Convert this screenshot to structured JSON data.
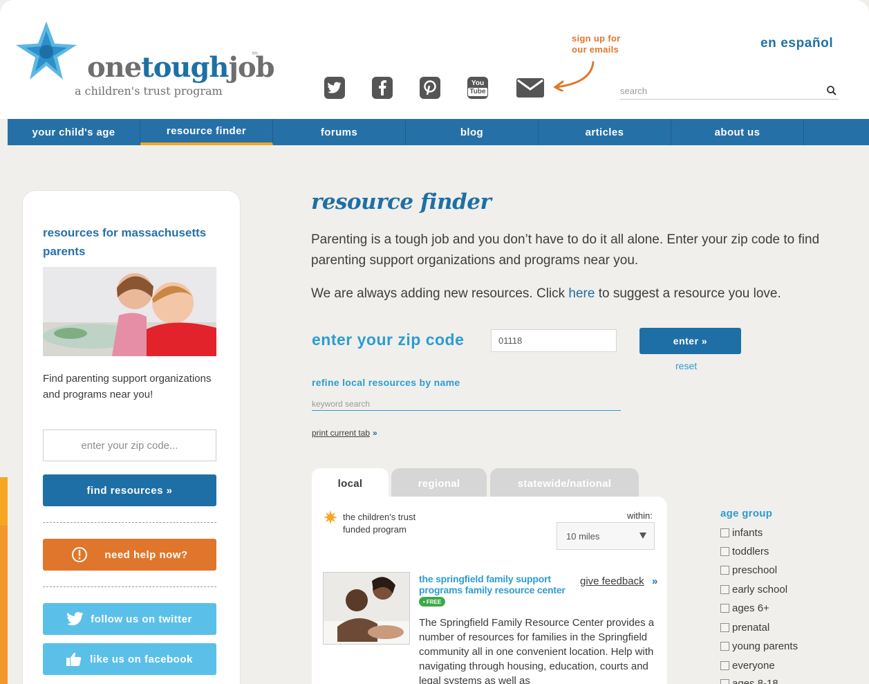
{
  "header": {
    "logo_word_one": "one",
    "logo_word_tough": "tough",
    "logo_word_job": "job",
    "logo_tm": "tm",
    "logo_sub": "a children's trust program",
    "signup_line1": "sign up for",
    "signup_line2": "our emails",
    "espanol": "en español",
    "search_placeholder": "search",
    "social_icons": [
      "twitter-icon",
      "facebook-icon",
      "pinterest-icon",
      "youtube-icon",
      "email-icon"
    ],
    "youtube_line1": "You",
    "youtube_line2": "Tube"
  },
  "nav": {
    "items": [
      {
        "label": "your child's age"
      },
      {
        "label": "resource finder"
      },
      {
        "label": "forums"
      },
      {
        "label": "blog"
      },
      {
        "label": "articles"
      },
      {
        "label": "about us"
      }
    ],
    "active_index": 1
  },
  "sidebar": {
    "title": "resources for massachusetts parents",
    "text": "Find parenting support organizations and programs near you!",
    "zip_placeholder": "enter your zip code...",
    "find_button": "find resources »",
    "help_button": "need help now?",
    "twitter_button": "follow us on twitter",
    "facebook_button": "like us on facebook"
  },
  "main": {
    "title": "resource finder",
    "intro": "Parenting is a tough job and you don’t have to do it all alone. Enter your zip code to find parenting support organizations and programs near you.",
    "intro2_before": "We are always adding new resources. Click ",
    "intro2_link": "here",
    "intro2_after": " to suggest a resource you love.",
    "zip_label": "enter your zip code",
    "zip_value": "01118",
    "enter_button": "enter »",
    "reset": "reset",
    "refine_label": "refine local resources by name",
    "keyword_placeholder": "keyword search",
    "print_label": "print current tab",
    "print_arrow": "»"
  },
  "tabs": [
    {
      "label": "local",
      "active": true
    },
    {
      "label": "regional",
      "active": false
    },
    {
      "label": "statewide/national",
      "active": false
    }
  ],
  "panel": {
    "legend_text": "the children's trust funded program",
    "within_label": "within:",
    "within_value": "10 miles",
    "resource": {
      "title": "the springfield family support programs family resource center",
      "badge": "• FREE",
      "feedback": "give feedback",
      "feedback_arrow": "»",
      "description": "The Springfield Family Resource Center provides a number of resources for families in the Springfield community all in one convenient location. Help with navigating through housing, education, courts and legal systems as well as"
    }
  },
  "age_group": {
    "title": "age group",
    "items": [
      "infants",
      "toddlers",
      "preschool",
      "early school",
      "ages 6+",
      "prenatal",
      "young parents",
      "everyone",
      "ages 8-18"
    ]
  },
  "colors": {
    "primary_blue": "#2670a8",
    "light_blue": "#2d9cd2",
    "orange": "#e0762b",
    "accent_yellow": "#f5a623",
    "twitter_blue": "#5bc0e8",
    "background": "#f0efeb"
  }
}
